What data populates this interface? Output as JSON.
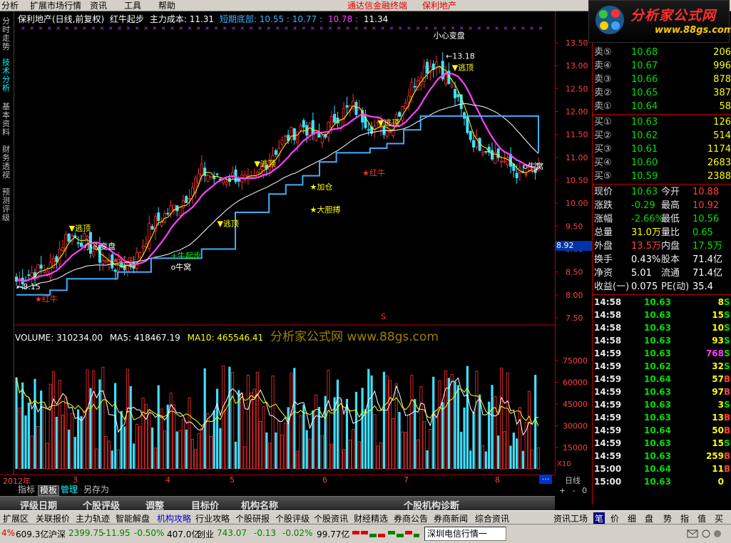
{
  "menu": {
    "items": [
      "分析",
      "扩展市场行情",
      "资讯",
      "工具",
      "帮助"
    ],
    "center_title": "通达信金融终端",
    "stock_title": "保利地产"
  },
  "logo": {
    "brand": "分析家公式网",
    "url": "www.88gs.com"
  },
  "left_tabs": [
    {
      "label": "分时走势",
      "active": false
    },
    {
      "label": "技术分析",
      "active": true
    },
    {
      "label": "基本资料",
      "active": false
    },
    {
      "label": "财务透视",
      "active": false
    },
    {
      "label": "预测评级",
      "active": false
    }
  ],
  "chart_header": {
    "stock": "保利地产(日线,前复权)",
    "indicator": "红牛起步",
    "cost_label": "主力成本: 11.31",
    "short_bottom_label": "短期底部: 10.55 : 10.77 :",
    "value_pink": "10.78 :",
    "value_white": "11.34"
  },
  "volume_header": {
    "volume": "VOLUME: 310234.00",
    "ma5": "MA5: 418467.19",
    "ma10": "MA10: 465546.41",
    "watermark": "分析家公式网 www.88gs.com"
  },
  "chart_data": {
    "type": "candlestick",
    "price_axis_ticks": [
      13.5,
      13.0,
      12.5,
      12.0,
      11.5,
      11.0,
      10.5,
      10.0,
      9.5,
      9.0,
      8.5,
      8.0,
      7.5
    ],
    "volume_axis_ticks": [
      75000,
      60000,
      45000,
      30000,
      15000
    ],
    "volume_axis_unit": "X10",
    "x_labels": [
      "2012年",
      "3",
      "4",
      "5",
      "6",
      "7",
      "8"
    ],
    "current_price_marker": 8.92,
    "high_label": 13.18,
    "low_label": 8.15,
    "annotations": [
      {
        "text": "逃顶",
        "color": "#ffff00"
      },
      {
        "text": "小心变盘",
        "color": "#ffffff"
      },
      {
        "text": "红牛",
        "color": "#ff3030"
      },
      {
        "text": "牛起步",
        "color": "#00ff00"
      },
      {
        "text": "牛窝",
        "color": "#ffffff"
      },
      {
        "text": "加仓",
        "color": "#ffff00"
      },
      {
        "text": "大胆搏",
        "color": "#ffff00"
      },
      {
        "text": "S",
        "color": "#ff3030"
      }
    ],
    "series_colors": {
      "up": "#ff3030",
      "down": "#40e0ff",
      "ma_pink": "#ff40ff",
      "ma_yellow": "#ffff00",
      "ma_white": "#ffffff",
      "support_blue": "#40b0ff"
    }
  },
  "quote": {
    "asks": [
      {
        "label": "卖⑤",
        "price": "10.68",
        "vol": "206"
      },
      {
        "label": "卖④",
        "price": "10.67",
        "vol": "996"
      },
      {
        "label": "卖③",
        "price": "10.66",
        "vol": "878"
      },
      {
        "label": "卖②",
        "price": "10.65",
        "vol": "387"
      },
      {
        "label": "卖①",
        "price": "10.64",
        "vol": "58"
      }
    ],
    "bids": [
      {
        "label": "买①",
        "price": "10.63",
        "vol": "126"
      },
      {
        "label": "买②",
        "price": "10.62",
        "vol": "514"
      },
      {
        "label": "买③",
        "price": "10.61",
        "vol": "1174"
      },
      {
        "label": "买④",
        "price": "10.60",
        "vol": "2683"
      },
      {
        "label": "买⑤",
        "price": "10.59",
        "vol": "2388"
      }
    ],
    "stats": [
      {
        "l1": "现价",
        "v1": "10.63",
        "c1": "#00e000",
        "l2": "今开",
        "v2": "10.88",
        "c2": "#ff4040"
      },
      {
        "l1": "涨跌",
        "v1": "-0.29",
        "c1": "#00e000",
        "l2": "最高",
        "v2": "10.92",
        "c2": "#ff4040"
      },
      {
        "l1": "涨幅",
        "v1": "-2.66%",
        "c1": "#00e000",
        "l2": "最低",
        "v2": "10.56",
        "c2": "#00e000"
      },
      {
        "l1": "总量",
        "v1": "31.0万",
        "c1": "#ffff00",
        "l2": "量比",
        "v2": "0.65",
        "c2": "#00e000"
      },
      {
        "l1": "外盘",
        "v1": "13.5万",
        "c1": "#ff4040",
        "l2": "内盘",
        "v2": "17.5万",
        "c2": "#00e000"
      },
      {
        "l1": "换手",
        "v1": "0.43%",
        "c1": "#ffffff",
        "l2": "股本",
        "v2": "71.4亿",
        "c2": "#ffffff"
      },
      {
        "l1": "净资",
        "v1": "5.01",
        "c1": "#ffffff",
        "l2": "流通",
        "v2": "71.4亿",
        "c2": "#ffffff"
      },
      {
        "l1": "收益(一)",
        "v1": "0.075",
        "c1": "#ffffff",
        "l2": "PE(动)",
        "v2": "35.4",
        "c2": "#ffffff"
      }
    ],
    "ticks": [
      {
        "time": "14:58",
        "price": "10.63",
        "vol": "8",
        "side": "S",
        "vc": "#ffff00"
      },
      {
        "time": "14:58",
        "price": "10.63",
        "vol": "15",
        "side": "S",
        "vc": "#ffff00"
      },
      {
        "time": "14:58",
        "price": "10.63",
        "vol": "10",
        "side": "S",
        "vc": "#ffff00"
      },
      {
        "time": "14:58",
        "price": "10.63",
        "vol": "93",
        "side": "S",
        "vc": "#ffff00"
      },
      {
        "time": "14:59",
        "price": "10.63",
        "vol": "768",
        "side": "S",
        "vc": "#ff40ff"
      },
      {
        "time": "14:59",
        "price": "10.62",
        "vol": "32",
        "side": "S",
        "vc": "#ffff00"
      },
      {
        "time": "14:59",
        "price": "10.64",
        "vol": "57",
        "side": "B",
        "vc": "#ffff00"
      },
      {
        "time": "14:59",
        "price": "10.63",
        "vol": "97",
        "side": "B",
        "vc": "#ffff00"
      },
      {
        "time": "14:59",
        "price": "10.63",
        "vol": "3",
        "side": "S",
        "vc": "#ffff00"
      },
      {
        "time": "14:59",
        "price": "10.63",
        "vol": "13",
        "side": "B",
        "vc": "#ffff00"
      },
      {
        "time": "14:59",
        "price": "10.64",
        "vol": "50",
        "side": "B",
        "vc": "#ffff00"
      },
      {
        "time": "14:59",
        "price": "10.63",
        "vol": "15",
        "side": "S",
        "vc": "#ffff00"
      },
      {
        "time": "14:59",
        "price": "10.63",
        "vol": "259",
        "side": "B",
        "vc": "#ffff00"
      },
      {
        "time": "15:00",
        "price": "10.64",
        "vol": "11",
        "side": "B",
        "vc": "#ffff00"
      },
      {
        "time": "15:00",
        "price": "10.63",
        "vol": "0",
        "side": "",
        "vc": "#ffff00"
      }
    ]
  },
  "controls": {
    "period": "日线",
    "zoom": "+ - 0",
    "more": "···"
  },
  "indicator_tabs": [
    "指标",
    "模板",
    "管理",
    "另存为"
  ],
  "function_bar": [
    "评级日期",
    "个股评级",
    "调整",
    "目标价",
    "机构名称",
    "个股机构诊断"
  ],
  "info_bar": [
    "扩展区",
    "关联报价",
    "主力轨迹",
    "智能解盘",
    "机构攻略",
    "行业攻略",
    "个股研报",
    "个股评级",
    "个股资讯",
    "财经精选",
    "券商公告",
    "券商新闻",
    "综合资讯",
    "资讯工场",
    "笔",
    "价",
    "细",
    "盘",
    "势",
    "指",
    "值",
    "买"
  ],
  "status": {
    "pct_left": "4%",
    "sh_amount": "609.3亿",
    "sz_label": "沪深",
    "sz_value": "2399.75",
    "sz_change": "-11.95",
    "sz_pct": "-0.50%",
    "sz_amount": "407.0亿",
    "cy_label": "创业",
    "cy_value": "743.07",
    "cy_change": "-0.13",
    "cy_pct": "-0.02%",
    "cy_amount": "99.77亿",
    "server": "深圳电信行情一"
  }
}
